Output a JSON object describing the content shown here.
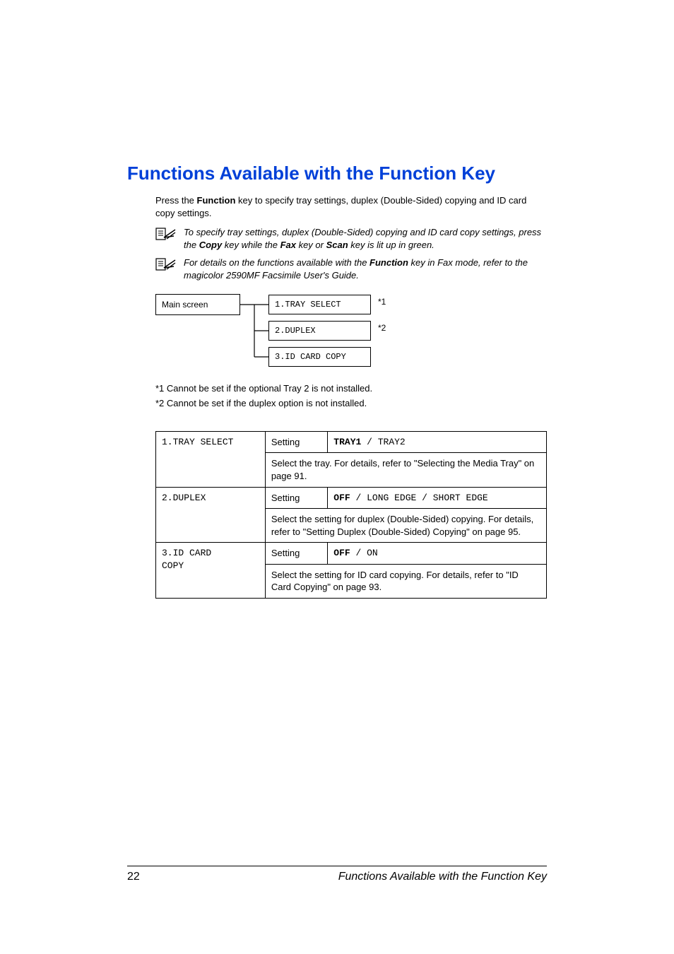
{
  "title": "Functions Available with the Function Key",
  "intro_parts": {
    "a": "Press the ",
    "b": "Function",
    "c": " key to specify tray settings, duplex (Double-Sided) copying and ID card copy settings."
  },
  "note1": {
    "a": "To specify tray settings, duplex (Double-Sided) copying and ID card copy settings, press the ",
    "copy": "Copy",
    "b": " key while the ",
    "fax": "Fax",
    "c": " key or ",
    "scan": "Scan",
    "d": " key is lit up in green."
  },
  "note2": {
    "a": "For details on the functions available with the ",
    "func": "Function",
    "b": " key in Fax mode, refer to the magicolor 2590MF Facsimile User's Guide."
  },
  "tree": {
    "main": "Main screen",
    "m1": "1.TRAY SELECT",
    "m2": "2.DUPLEX",
    "m3": "3.ID CARD COPY",
    "a1": "*1",
    "a2": "*2"
  },
  "footnotes": {
    "f1": "*1  Cannot be set if the optional Tray 2 is not installed.",
    "f2": "*2  Cannot be set if the duplex option is not installed."
  },
  "table": {
    "setting_label": "Setting",
    "r1_menu": "1.TRAY SELECT",
    "r1_val_bold": "TRAY1",
    "r1_val_rest": " / TRAY2",
    "r1_desc": "Select the tray. For details, refer to \"Selecting the Media Tray\" on page 91.",
    "r2_menu": "2.DUPLEX",
    "r2_val_bold": "OFF",
    "r2_val_rest": " / LONG EDGE / SHORT EDGE",
    "r2_desc": "Select the setting for duplex (Double-Sided) copying. For details, refer to \"Setting Duplex (Double-Sided) Copying\" on page 95.",
    "r3_menu_a": "3.ID CARD",
    "r3_menu_b": "COPY",
    "r3_val_bold": "OFF",
    "r3_val_rest": " / ON",
    "r3_desc": "Select the setting for ID card copying. For details, refer to \"ID Card Copying\" on page 93."
  },
  "footer": {
    "page": "22",
    "title": "Functions Available with the Function Key"
  }
}
